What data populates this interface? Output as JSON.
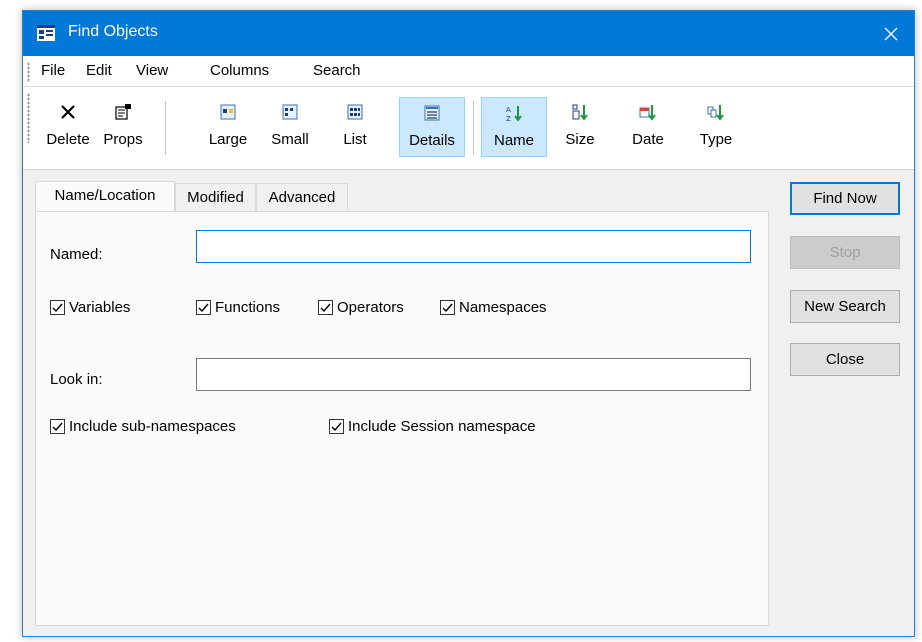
{
  "window": {
    "title": "Find Objects",
    "accent_color": "#0078d7",
    "icon": "app-icon"
  },
  "menu": {
    "items": [
      "File",
      "Edit",
      "View",
      "Columns",
      "Search"
    ]
  },
  "toolbar": {
    "delete_label": "Delete",
    "props_label": "Props",
    "large_label": "Large",
    "small_label": "Small",
    "list_label": "List",
    "details_label": "Details",
    "name_label": "Name",
    "size_label": "Size",
    "date_label": "Date",
    "type_label": "Type",
    "pressed": [
      "Details",
      "Name"
    ]
  },
  "tabs": [
    {
      "label": "Name/Location",
      "active": true
    },
    {
      "label": "Modified",
      "active": false
    },
    {
      "label": "Advanced",
      "active": false
    }
  ],
  "form": {
    "named_label": "Named:",
    "named_value": "",
    "look_in_label": "Look in:",
    "look_in_value": "",
    "checkboxes": [
      {
        "label": "Variables",
        "checked": true
      },
      {
        "label": "Functions",
        "checked": true
      },
      {
        "label": "Operators",
        "checked": true
      },
      {
        "label": "Namespaces",
        "checked": true
      },
      {
        "label": "Include sub-namespaces",
        "checked": true
      },
      {
        "label": "Include Session namespace",
        "checked": true
      }
    ]
  },
  "buttons": {
    "find_now": "Find Now",
    "stop": "Stop",
    "new_search": "New Search",
    "close": "Close"
  }
}
